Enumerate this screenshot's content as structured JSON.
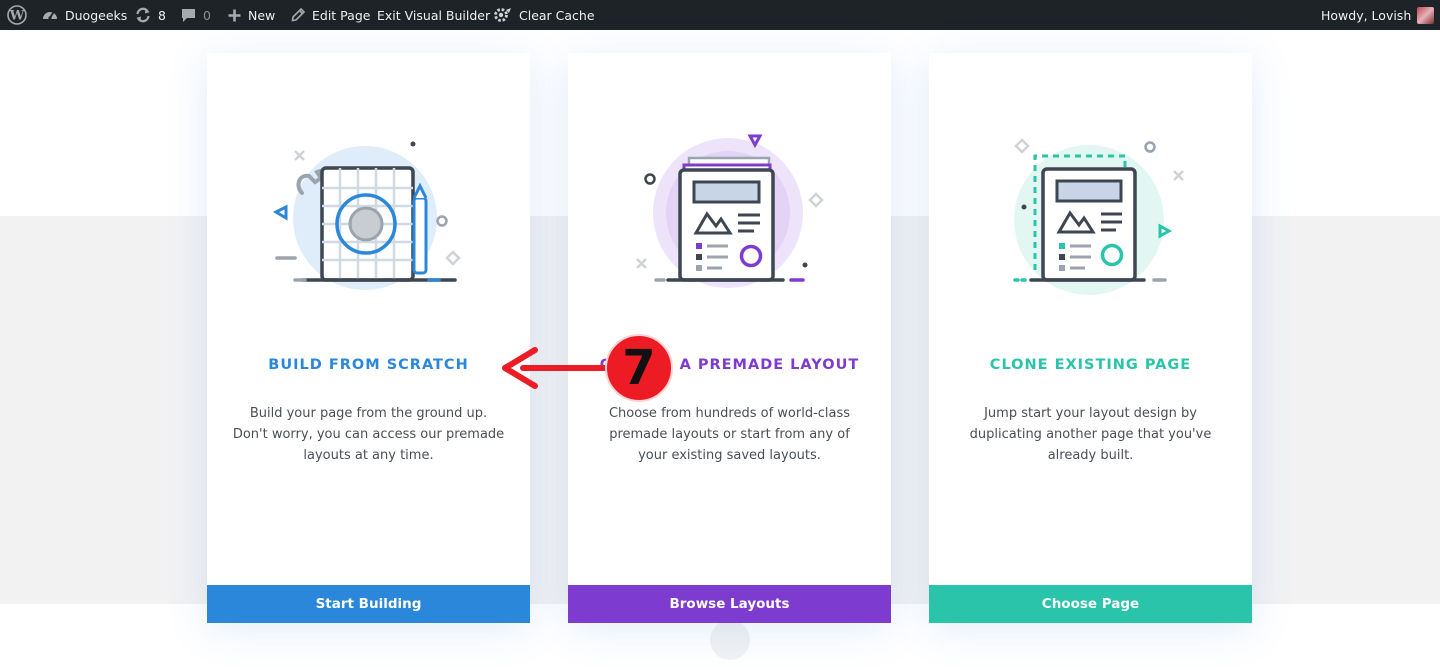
{
  "admin_bar": {
    "site_name": "Duogeeks",
    "updates_count": "8",
    "comments_count": "0",
    "new_label": "New",
    "edit_page_label": "Edit Page",
    "exit_builder_label": "Exit Visual Builder",
    "clear_cache_label": "Clear Cache",
    "greeting": "Howdy, Lovish"
  },
  "cards": [
    {
      "title": "BUILD FROM SCRATCH",
      "description": "Build your page from the ground up. Don't worry, you can access our premade layouts at any time.",
      "button": "Start Building",
      "accent": "#2b87da"
    },
    {
      "title": "CHOOSE A PREMADE LAYOUT",
      "description": "Choose from hundreds of world-class premade layouts or start from any of your existing saved layouts.",
      "button": "Browse Layouts",
      "accent": "#7e3bd0"
    },
    {
      "title": "CLONE EXISTING PAGE",
      "description": "Jump start your layout design by duplicating another page that you've already built.",
      "button": "Choose Page",
      "accent": "#29c4a9"
    }
  ],
  "annotation": {
    "number": "7",
    "color": "#ed1c24"
  },
  "icons": {
    "wordpress": "wordpress-logo-icon",
    "dashboard": "dashboard-gauge-icon",
    "updates": "refresh-icon",
    "comments": "comment-bubble-icon",
    "new": "plus-icon",
    "edit": "pencil-icon",
    "cache": "cache-gear-icon"
  }
}
